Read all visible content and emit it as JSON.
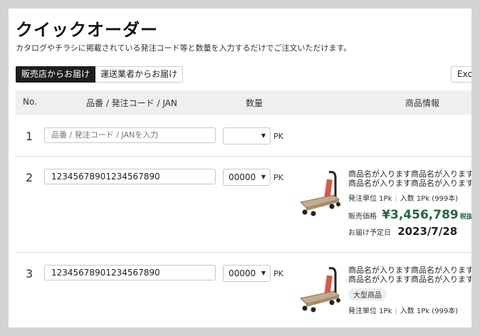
{
  "header": {
    "title": "クイックオーダー",
    "subtitle": "カタログやチラシに掲載されている発注コード等と数量を入力するだけでご注文いただけます。"
  },
  "tabs": [
    {
      "label": "販売店からお届け",
      "active": true
    },
    {
      "label": "運送業者からお届け",
      "active": false
    }
  ],
  "export_label": "Exc",
  "table": {
    "headers": {
      "no": "No.",
      "code": "品番 / 発注コード / JAN",
      "qty": "数量",
      "info": "商品情報"
    },
    "rows": [
      {
        "no": "1",
        "code_value": "",
        "code_placeholder": "品番 / 発注コード / JANを入力",
        "qty": "",
        "unit": "PK"
      },
      {
        "no": "2",
        "code_value": "12345678901234567890",
        "qty": "00000",
        "unit": "PK",
        "product": {
          "name_line1": "商品名が入ります商品名が入ります",
          "name_line2": "商品名が入ります商品名が入ります",
          "order_unit": "発注単位 1Pk",
          "pack_qty": "入数 1Pk (999本)",
          "price_label": "販売価格",
          "price": "¥3,456,789",
          "tax_note": "税抜",
          "delivery_label": "お届け予定日",
          "delivery_date": "2023/7/28"
        }
      },
      {
        "no": "3",
        "code_value": "12345678901234567890",
        "qty": "00000",
        "unit": "PK",
        "product": {
          "name_line1": "商品名が入ります商品名が入ります",
          "name_line2": "商品名が入ります商品名が入ります",
          "badge": "大型商品",
          "order_unit": "発注単位 1Pk",
          "pack_qty": "入数 1Pk (999本)"
        }
      }
    ]
  },
  "icons": {
    "dropdown": "caret-down-icon",
    "product_image": "hand-truck-cart-icon"
  },
  "colors": {
    "price": "#1f6a3a",
    "active_tab": "#1e1e1e",
    "header_bg": "#efefef"
  }
}
